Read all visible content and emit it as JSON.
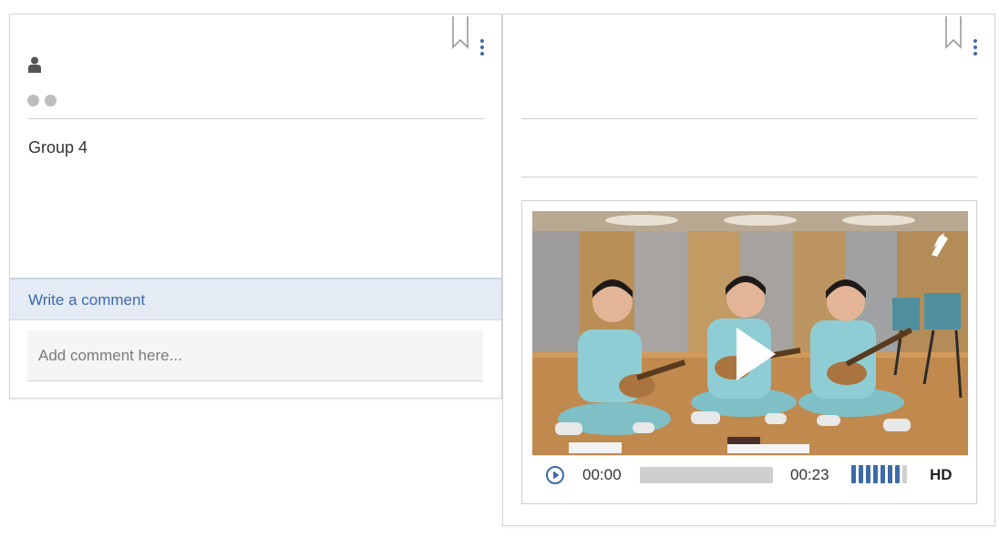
{
  "cards": [
    {
      "body_text": "Group 4",
      "comment_bar_label": "Write a comment",
      "comment_placeholder": "Add comment here..."
    },
    {
      "video": {
        "current_time": "00:00",
        "duration": "00:23",
        "progress_fraction": 0,
        "volume_level": 0.875,
        "quality_label": "HD"
      }
    }
  ],
  "colors": {
    "accent": "#3d6aa8",
    "comment_bar_bg": "#e4ebf5"
  },
  "icons": [
    "bookmark-icon",
    "more-vertical-icon",
    "user-icon",
    "play-icon",
    "pip-icon"
  ]
}
